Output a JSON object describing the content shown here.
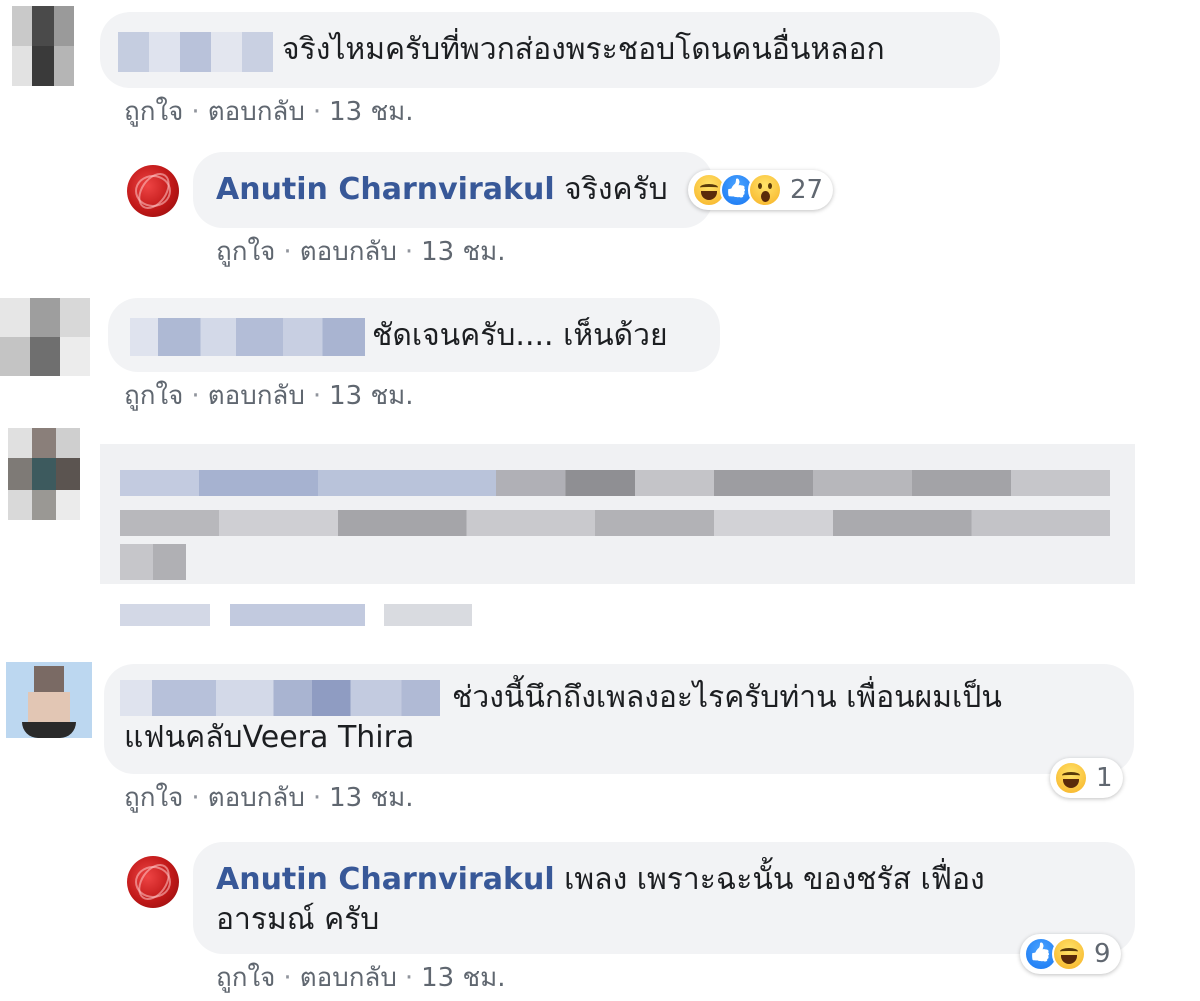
{
  "actions": {
    "like": "ถูกใจ",
    "reply": "ตอบกลับ",
    "dot": "·",
    "time": "13 ชม."
  },
  "comments": [
    {
      "text": "จริงไหมครับที่พวกส่องพระชอบโดนคนอื่นหลอก"
    },
    {
      "author": "Anutin Charnvirakul",
      "text": "จริงครับ",
      "reactions": [
        "haha-icon",
        "like-icon",
        "wow-icon"
      ],
      "reaction_count": "27"
    },
    {
      "text": "ชัดเจนครับ.... เห็นด้วย"
    },
    {
      "text": ""
    },
    {
      "text_line1": "ช่วงนี้นึกถึงเพลงอะไรครับท่าน เพื่อนผมเป็น",
      "text_line2": "แฟนคลับVeera Thira",
      "reactions": [
        "haha-icon"
      ],
      "reaction_count": "1"
    },
    {
      "author": "Anutin Charnvirakul",
      "text_line1": "เพลง เพราะฉะนั้น ของชรัส เฟื่อง",
      "text_line2": "อารมณ์ ครับ",
      "reactions": [
        "like-icon",
        "haha-icon"
      ],
      "reaction_count": "9"
    }
  ],
  "colors": {
    "author": "#385898",
    "bubble": "#f2f3f5",
    "meta": "#606770"
  }
}
